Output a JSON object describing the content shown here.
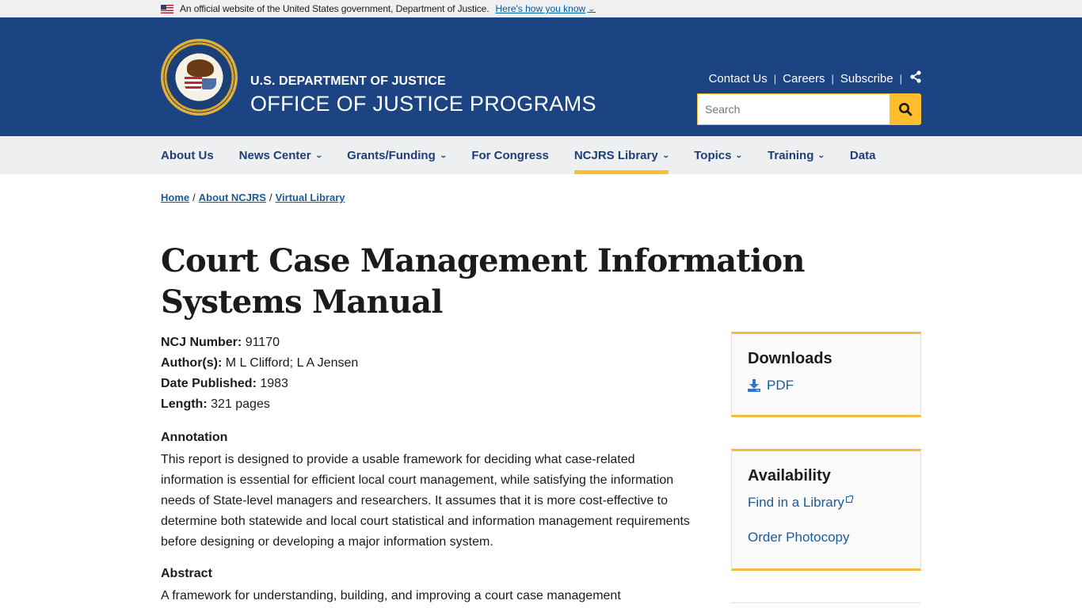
{
  "gov_banner": {
    "text": "An official website of the United States government, Department of Justice.",
    "how_link": "Here's how you know",
    "flag_icon": "us-flag-icon"
  },
  "header": {
    "department": "U.S. DEPARTMENT OF JUSTICE",
    "office": "OFFICE OF JUSTICE PROGRAMS",
    "utility_links": [
      "Contact Us",
      "Careers",
      "Subscribe"
    ],
    "search": {
      "placeholder": "Search",
      "value": ""
    },
    "colors": {
      "header_bg": "#1c4382",
      "accent": "#ffbe2e"
    }
  },
  "nav": {
    "items": [
      {
        "label": "About Us",
        "dropdown": false,
        "active": false
      },
      {
        "label": "News Center",
        "dropdown": true,
        "active": false
      },
      {
        "label": "Grants/Funding",
        "dropdown": true,
        "active": false
      },
      {
        "label": "For Congress",
        "dropdown": false,
        "active": false
      },
      {
        "label": "NCJRS Library",
        "dropdown": true,
        "active": true
      },
      {
        "label": "Topics",
        "dropdown": true,
        "active": false
      },
      {
        "label": "Training",
        "dropdown": true,
        "active": false
      },
      {
        "label": "Data",
        "dropdown": false,
        "active": false
      }
    ]
  },
  "breadcrumb": [
    "Home",
    "About NCJRS",
    "Virtual Library"
  ],
  "page": {
    "title": "Court Case Management Information Systems Manual",
    "meta": [
      {
        "label": "NCJ Number:",
        "value": "91170"
      },
      {
        "label": "Author(s):",
        "value": "M L Clifford; L A Jensen"
      },
      {
        "label": "Date Published:",
        "value": "1983"
      },
      {
        "label": "Length:",
        "value": "321 pages"
      }
    ],
    "annotation": {
      "heading": "Annotation",
      "text": "This report is designed to provide a usable framework for deciding what case-related information is essential for efficient local court management, while satisfying the information needs of State-level managers and researchers. It assumes that it is more cost-effective to determine both statewide and local court statistical and information management requirements before designing or developing a major information system."
    },
    "abstract": {
      "heading": "Abstract",
      "text": "A framework for understanding, building, and improving a court case management"
    }
  },
  "sidebar": {
    "downloads": {
      "heading": "Downloads",
      "links": [
        "PDF"
      ]
    },
    "availability": {
      "heading": "Availability",
      "links": [
        "Find in a Library",
        "Order Photocopy"
      ]
    }
  }
}
